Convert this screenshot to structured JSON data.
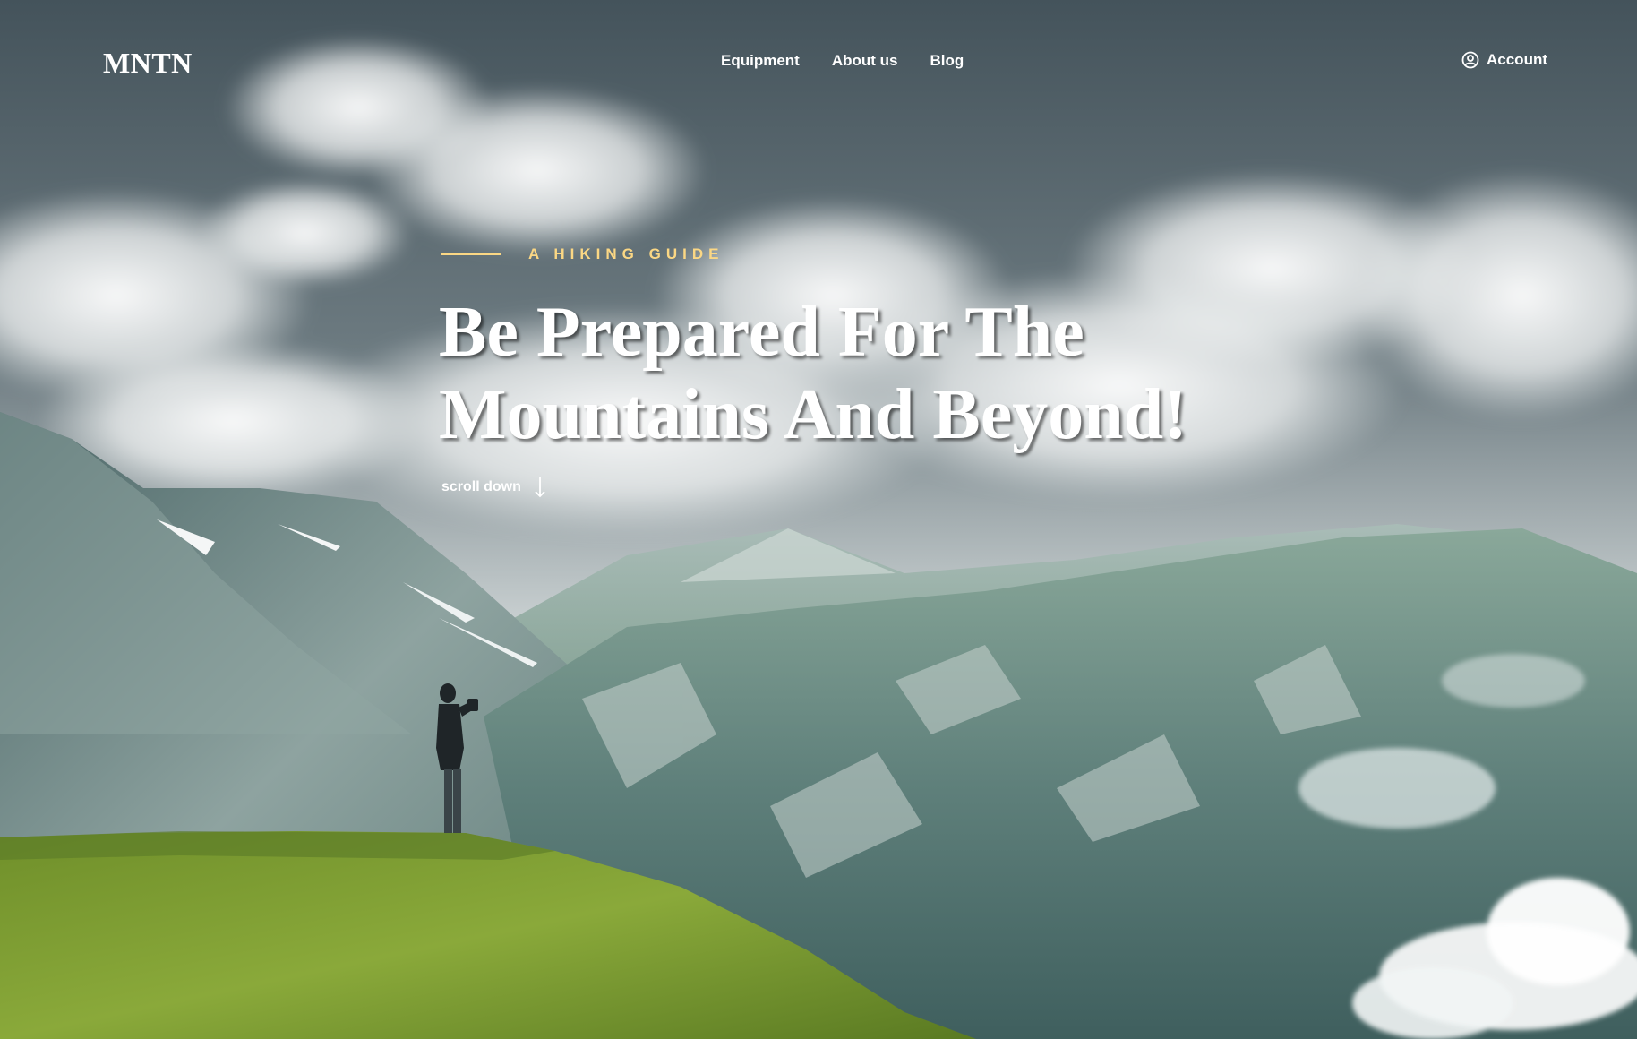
{
  "header": {
    "logo": "MNTN",
    "nav": [
      "Equipment",
      "About us",
      "Blog"
    ],
    "account_label": "Account",
    "account_icon": "user-circle-icon"
  },
  "hero": {
    "eyebrow": "A HIKING GUIDE",
    "headline_line1": "Be Prepared For The",
    "headline_line2": "Mountains And Beyond!",
    "scroll_label": "scroll down",
    "scroll_icon": "arrow-down-icon"
  },
  "colors": {
    "accent": "#fbd784",
    "text": "#ffffff",
    "sky": "#5f7078",
    "mountain": "#6d8f8a",
    "grass": "#7a9a2c"
  }
}
